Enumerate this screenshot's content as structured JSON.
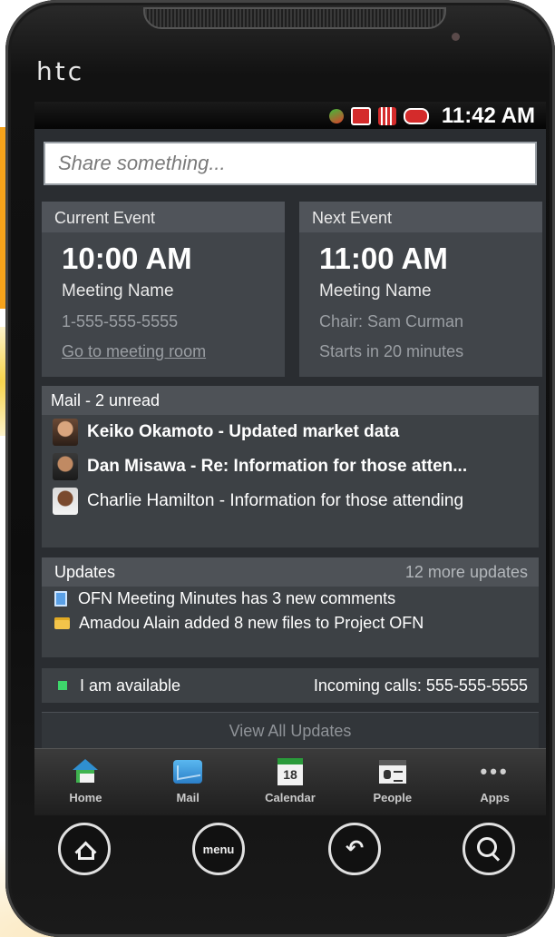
{
  "device": {
    "brand": "htc"
  },
  "statusbar": {
    "time": "11:42 AM",
    "icons": [
      "sync-icon",
      "message-icon",
      "signal-icon",
      "battery-icon"
    ]
  },
  "share": {
    "placeholder": "Share something..."
  },
  "current_event": {
    "header": "Current Event",
    "time": "10:00 AM",
    "name": "Meeting Name",
    "phone": "1-555-555-5555",
    "link": "Go to meeting room"
  },
  "next_event": {
    "header": "Next Event",
    "time": "11:00 AM",
    "name": "Meeting Name",
    "chair": "Chair: Sam Curman",
    "starts": "Starts in 20 minutes"
  },
  "mail": {
    "header": "Mail - 2 unread",
    "items": [
      {
        "text": "Keiko Okamoto - Updated market data",
        "unread": true
      },
      {
        "text": "Dan Misawa - Re: Information for those atten...",
        "unread": true
      },
      {
        "text": "Charlie Hamilton - Information for those attending",
        "unread": false
      }
    ]
  },
  "updates": {
    "header": "Updates",
    "more": "12 more updates",
    "items": [
      {
        "icon": "document-icon",
        "text": "OFN Meeting Minutes has 3 new comments"
      },
      {
        "icon": "folder-icon",
        "text": "Amadou Alain added 8 new files to Project OFN"
      }
    ]
  },
  "availability": {
    "status": "I am available",
    "incoming": "Incoming calls: 555-555-5555",
    "status_color": "#3ed66b"
  },
  "view_all": "View All Updates",
  "tabs": [
    {
      "label": "Home",
      "icon": "home-icon"
    },
    {
      "label": "Mail",
      "icon": "mail-icon"
    },
    {
      "label": "Calendar",
      "icon": "calendar-icon",
      "day": "18"
    },
    {
      "label": "People",
      "icon": "people-icon"
    },
    {
      "label": "Apps",
      "icon": "apps-icon"
    }
  ],
  "hardware_buttons": {
    "home": "home-icon",
    "menu": "menu",
    "back": "back-icon",
    "search": "search-icon"
  }
}
